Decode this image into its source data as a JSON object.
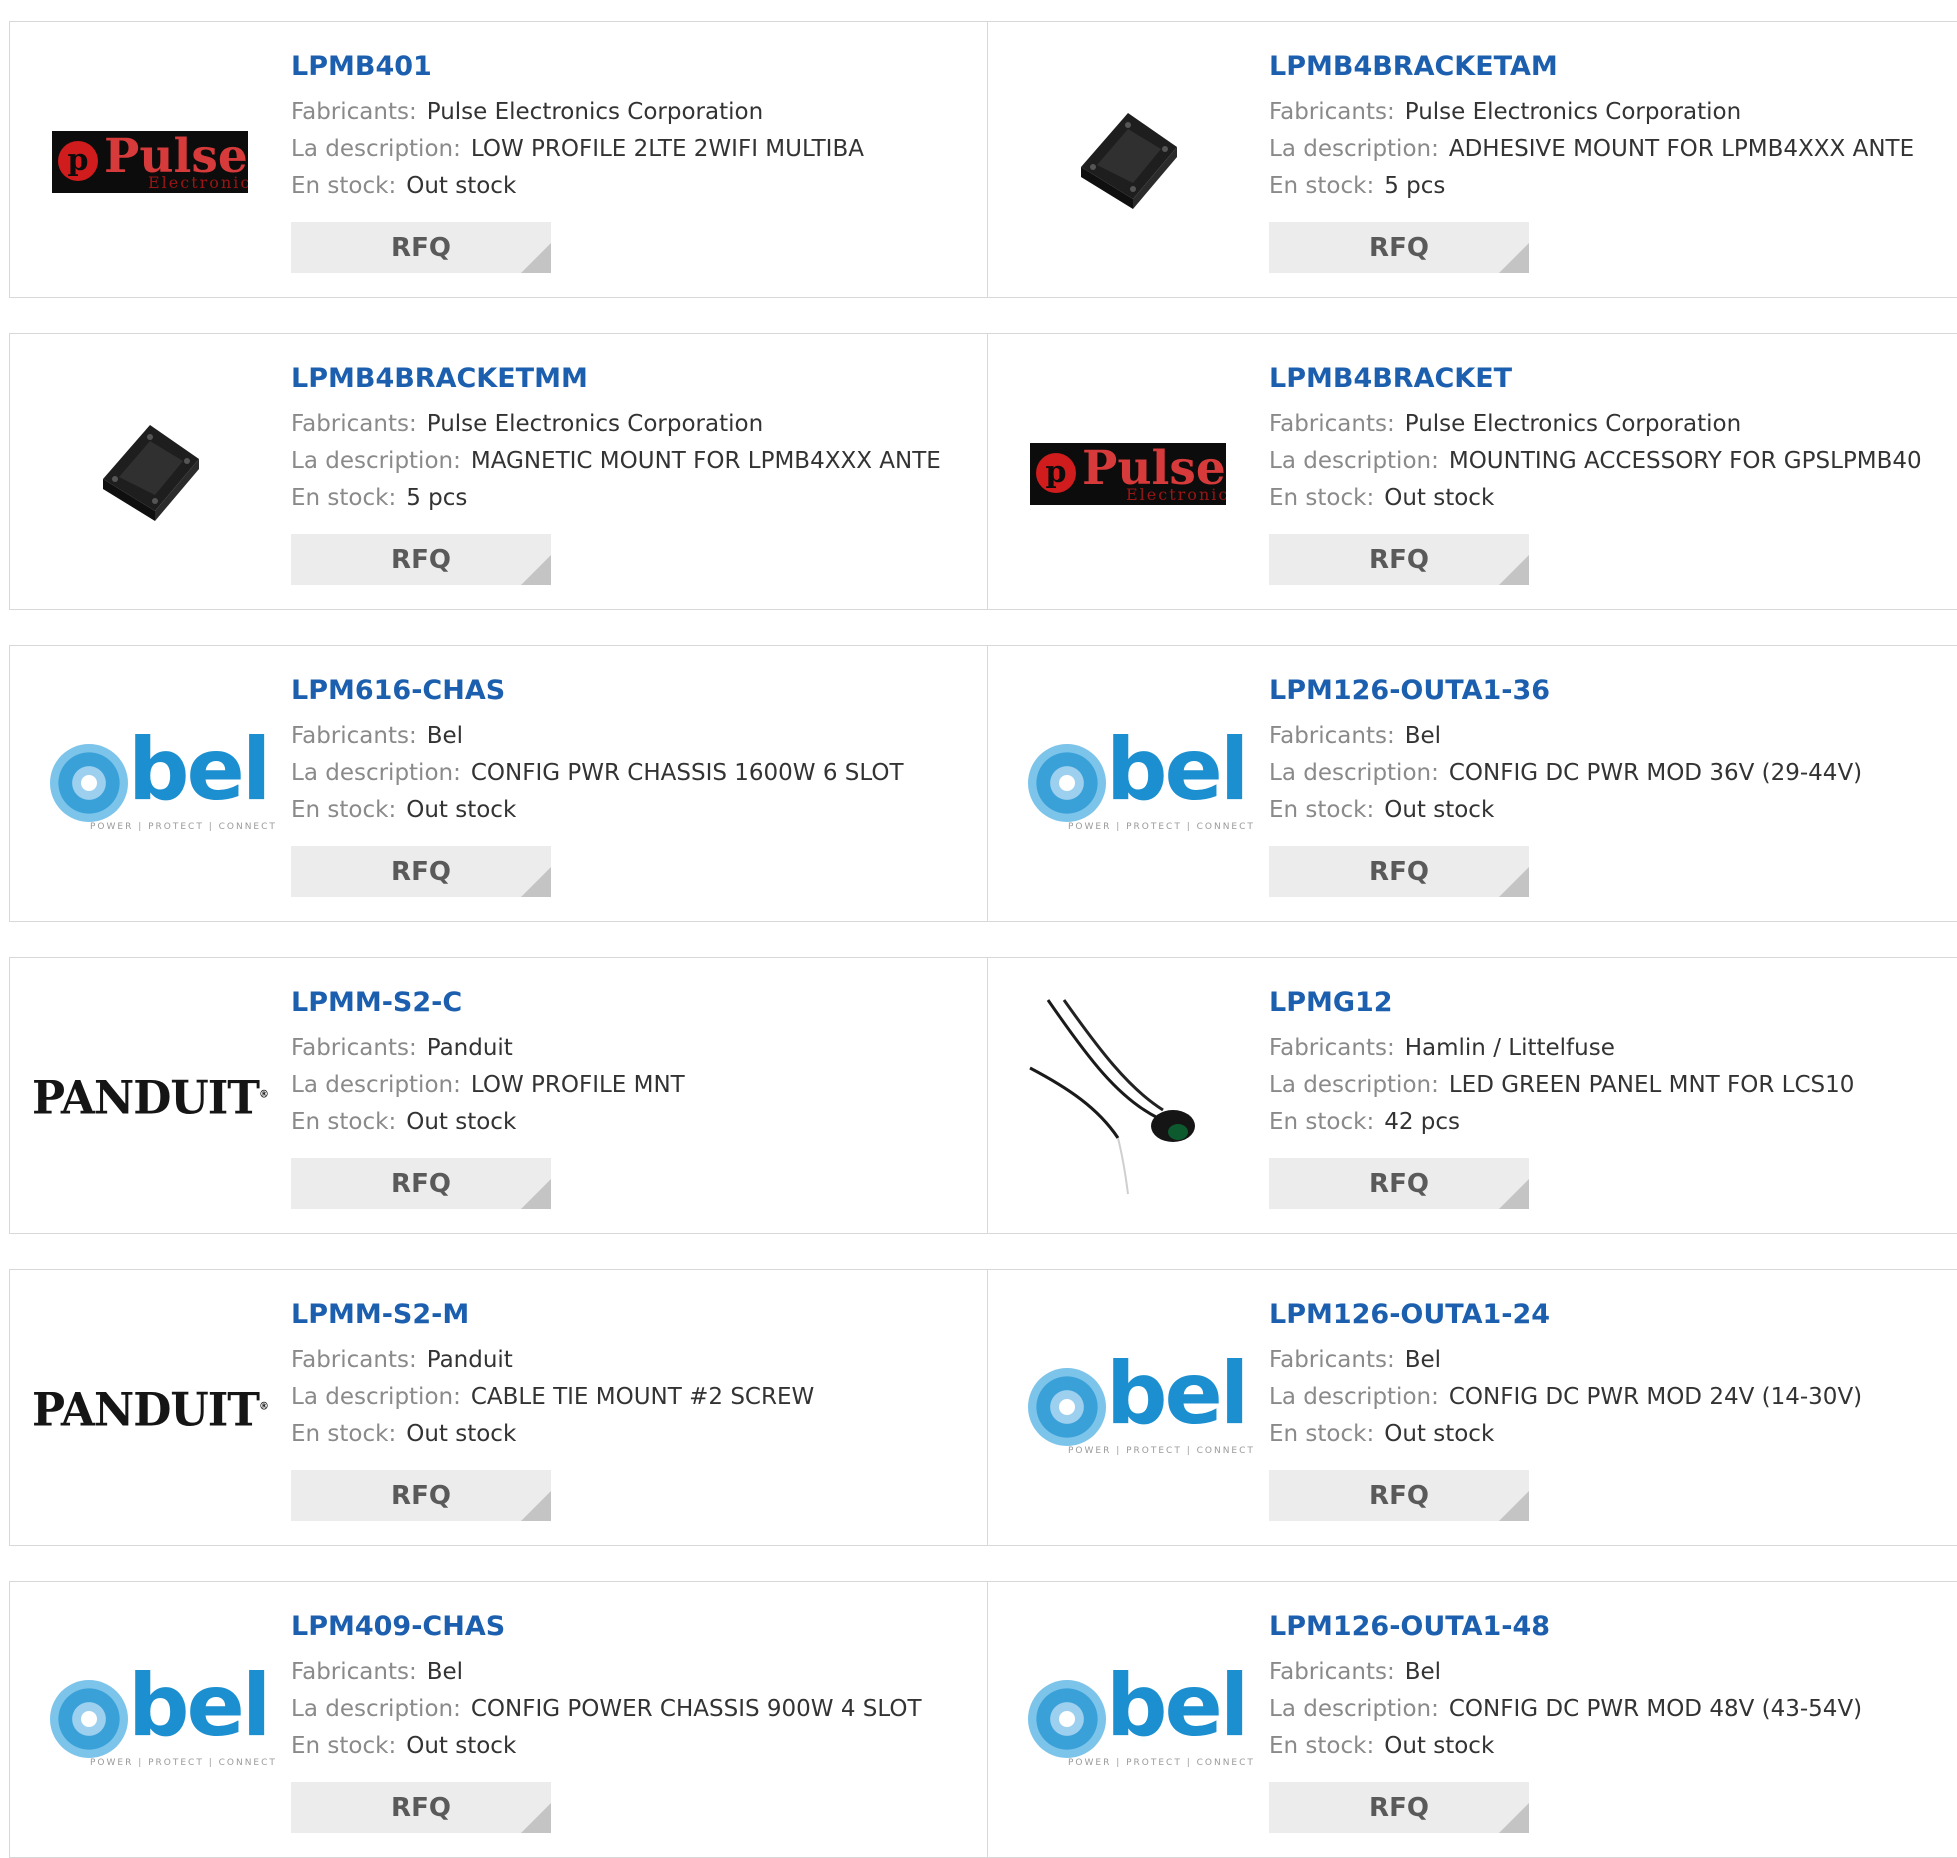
{
  "labels": {
    "manufacturer": "Fabricants:",
    "description": "La description:",
    "stock": "En stock:",
    "rfq": "RFQ"
  },
  "logos": {
    "pulse_word": "Pulse",
    "pulse_sub": "Electronics",
    "bel_word": "bel",
    "bel_tag": "POWER | PROTECT | CONNECT",
    "panduit_word": "PANDUIT",
    "panduit_reg": "®"
  },
  "products": [
    {
      "part": "LPMB401",
      "manufacturer": "Pulse Electronics Corporation",
      "description": "LOW PROFILE 2LTE 2WIFI MULTIBA",
      "stock": "Out stock",
      "image": "pulse-logo"
    },
    {
      "part": "LPMB4BRACKETAM",
      "manufacturer": "Pulse Electronics Corporation",
      "description": "ADHESIVE MOUNT FOR LPMB4XXX ANTE",
      "stock": "5 pcs",
      "image": "bracket-photo"
    },
    {
      "part": "LPMB4BRACKETMM",
      "manufacturer": "Pulse Electronics Corporation",
      "description": "MAGNETIC MOUNT FOR LPMB4XXX ANTE",
      "stock": "5 pcs",
      "image": "bracket-photo"
    },
    {
      "part": "LPMB4BRACKET",
      "manufacturer": "Pulse Electronics Corporation",
      "description": "MOUNTING ACCESSORY FOR GPSLPMB40",
      "stock": "Out stock",
      "image": "pulse-logo"
    },
    {
      "part": "LPM616-CHAS",
      "manufacturer": "Bel",
      "description": "CONFIG PWR CHASSIS 1600W 6 SLOT",
      "stock": "Out stock",
      "image": "bel-logo"
    },
    {
      "part": "LPM126-OUTA1-36",
      "manufacturer": "Bel",
      "description": "CONFIG DC PWR MOD 36V (29-44V)",
      "stock": "Out stock",
      "image": "bel-logo"
    },
    {
      "part": "LPMM-S2-C",
      "manufacturer": "Panduit",
      "description": "LOW PROFILE MNT",
      "stock": "Out stock",
      "image": "panduit-logo"
    },
    {
      "part": "LPMG12",
      "manufacturer": "Hamlin / Littelfuse",
      "description": "LED GREEN PANEL MNT FOR LCS10",
      "stock": "42 pcs",
      "image": "cable-photo"
    },
    {
      "part": "LPMM-S2-M",
      "manufacturer": "Panduit",
      "description": "CABLE TIE MOUNT #2 SCREW",
      "stock": "Out stock",
      "image": "panduit-logo"
    },
    {
      "part": "LPM126-OUTA1-24",
      "manufacturer": "Bel",
      "description": "CONFIG DC PWR MOD 24V (14-30V)",
      "stock": "Out stock",
      "image": "bel-logo"
    },
    {
      "part": "LPM409-CHAS",
      "manufacturer": "Bel",
      "description": "CONFIG POWER CHASSIS 900W 4 SLOT",
      "stock": "Out stock",
      "image": "bel-logo"
    },
    {
      "part": "LPM126-OUTA1-48",
      "manufacturer": "Bel",
      "description": "CONFIG DC PWR MOD 48V (43-54V)",
      "stock": "Out stock",
      "image": "bel-logo"
    }
  ]
}
